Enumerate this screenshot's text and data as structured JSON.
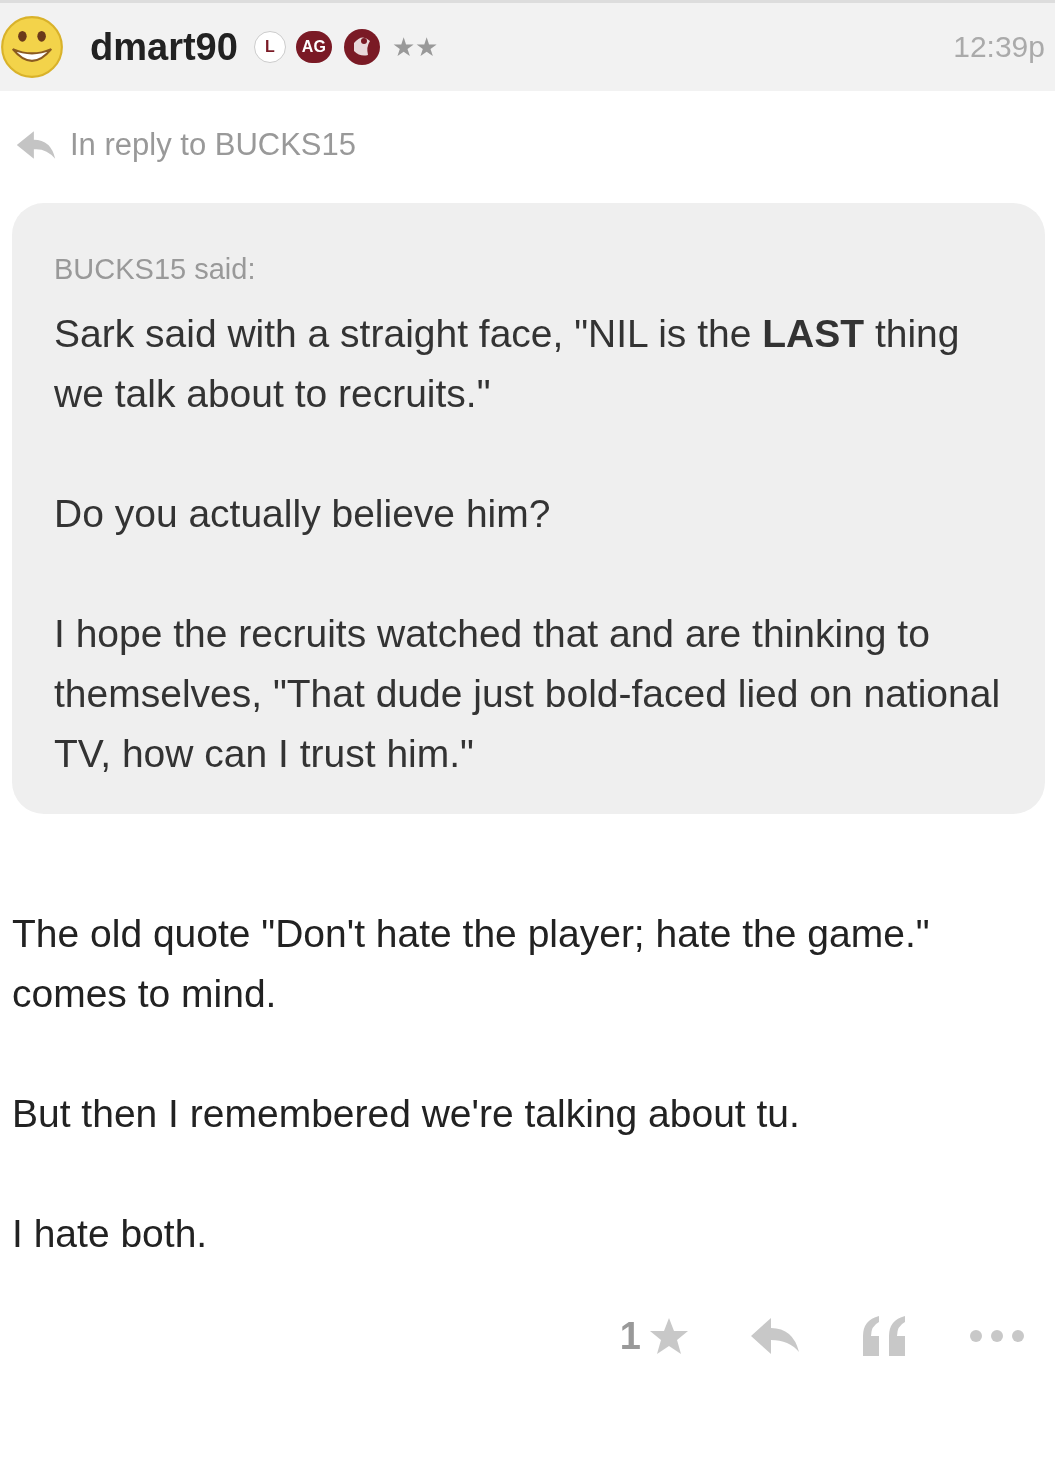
{
  "post": {
    "username": "dmart90",
    "badges": [
      {
        "label": "L",
        "kind": "outline"
      },
      {
        "label": "AG",
        "kind": "filled"
      }
    ],
    "rank_stars": "★★",
    "time": "12:39p"
  },
  "reply_to": "In reply to BUCKS15",
  "quote": {
    "attribution": "BUCKS15 said:",
    "paragraphs": [
      "Sark said with a straight face, \"NIL is the **LAST** thing we talk about to recruits.\"",
      "Do you actually believe him?",
      "I hope the recruits watched that and are thinking to themselves, \"That dude just bold-faced lied on national TV, how can I trust him.\""
    ]
  },
  "body": [
    "The old quote \"Don't hate the player; hate the game.\" comes to mind.",
    "But then I remembered we're talking about tu.",
    "I hate both."
  ],
  "footer": {
    "like_count": "1"
  }
}
